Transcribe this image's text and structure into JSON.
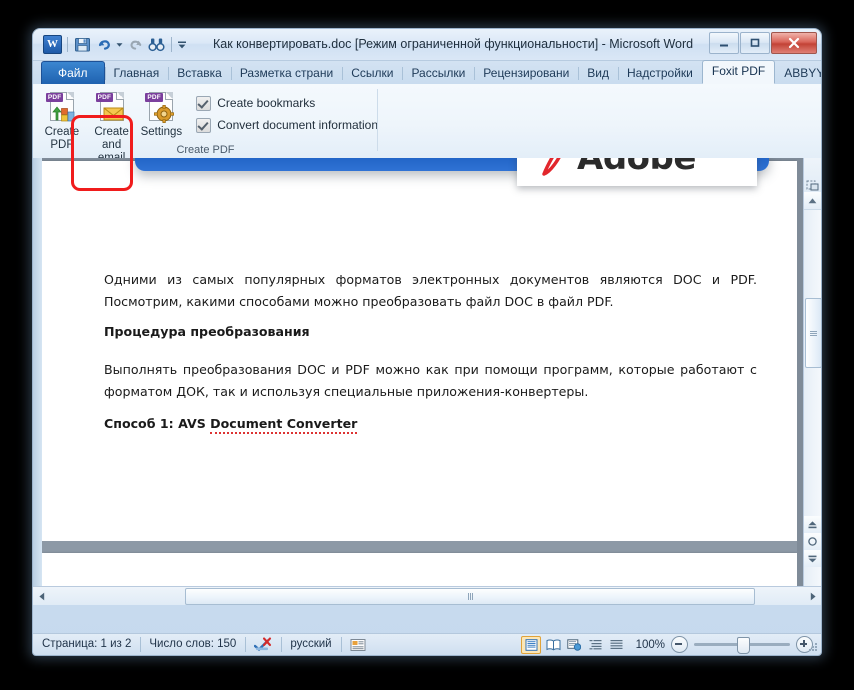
{
  "window": {
    "title": "Как конвертировать.doc [Режим ограниченной функциональности]  -  Microsoft Word",
    "app_icon_letter": "W",
    "buttons": {
      "minimize": "minimize-button",
      "maximize": "maximize-button",
      "close": "close-button"
    }
  },
  "quick_access": [
    {
      "name": "save-icon",
      "label": "Сохранить"
    },
    {
      "name": "undo-icon",
      "label": "Отменить"
    },
    {
      "name": "undo-dropdown-icon",
      "label": "Отменить список"
    },
    {
      "name": "redo-icon",
      "label": "Вернуть"
    },
    {
      "name": "find-icon",
      "label": "Найти"
    },
    {
      "name": "customize-qat-icon",
      "label": "Настройка панели быстрого доступа"
    }
  ],
  "ribbon": {
    "tabs": [
      {
        "label": "Файл",
        "type": "file"
      },
      {
        "label": "Главная",
        "type": "normal"
      },
      {
        "label": "Вставка",
        "type": "normal"
      },
      {
        "label": "Разметка страни",
        "type": "normal"
      },
      {
        "label": "Ссылки",
        "type": "normal"
      },
      {
        "label": "Рассылки",
        "type": "normal"
      },
      {
        "label": "Рецензировани",
        "type": "normal"
      },
      {
        "label": "Вид",
        "type": "normal"
      },
      {
        "label": "Надстройки",
        "type": "normal"
      },
      {
        "label": "Foxit PDF",
        "type": "active"
      },
      {
        "label": "ABBYY PDF Trans",
        "type": "normal"
      }
    ],
    "help_icon": "help-icon",
    "collapse_icon": "collapse-ribbon-icon",
    "group": {
      "label": "Create PDF",
      "buttons": [
        {
          "name": "create-pdf-button",
          "line1": "Create",
          "line2": "PDF"
        },
        {
          "name": "create-and-email-button",
          "line1": "Create",
          "line2": "and email"
        },
        {
          "name": "settings-button",
          "line1": "Settings",
          "line2": ""
        }
      ],
      "checkboxes": [
        {
          "name": "create-bookmarks-checkbox",
          "label": "Create bookmarks",
          "checked": true
        },
        {
          "name": "convert-document-information-checkbox",
          "label": "Convert document information",
          "checked": true
        }
      ]
    }
  },
  "document": {
    "banner_brand": "Adobe",
    "paragraphs": [
      {
        "style": "normal",
        "text": "Одними из самых популярных форматов электронных документов являются DOC и PDF. Посмотрим, какими способами можно преобразовать файл DOC в файл PDF."
      },
      {
        "style": "bold",
        "text": "Процедура преобразования"
      },
      {
        "style": "normal",
        "text": "Выполнять преобразования DOC и PDF можно как при помощи программ, которые работают с форматом ДОК, так и используя специальные приложения-конвертеры."
      }
    ],
    "heading_prefix": "Способ 1: AVS ",
    "heading_spelled": "Document Converter"
  },
  "status_bar": {
    "page": "Страница: 1 из 2",
    "words": "Число слов: 150",
    "proofing_icon": "spellcheck-error-icon",
    "language": "русский",
    "macro_icon": "record-macro-icon",
    "view_buttons": [
      {
        "name": "print-layout-view-button",
        "selected": true
      },
      {
        "name": "full-screen-reading-view-button",
        "selected": false
      },
      {
        "name": "web-layout-view-button",
        "selected": false
      },
      {
        "name": "outline-view-button",
        "selected": false
      },
      {
        "name": "draft-view-button",
        "selected": false
      }
    ],
    "zoom_level": "100%",
    "zoom_out_icon": "zoom-out-icon",
    "zoom_in_icon": "zoom-in-icon"
  },
  "scrollbars": {
    "vertical": {
      "up_icon": "scroll-up-icon",
      "down_icon": "scroll-down-icon",
      "previous_page_icon": "previous-page-icon",
      "select_browse_object_icon": "select-browse-object-icon",
      "next_page_icon": "next-page-icon",
      "split_icon": "split-window-icon",
      "object_icon": "select-object-icon"
    },
    "horizontal": {
      "left_icon": "scroll-left-icon",
      "right_icon": "scroll-right-icon"
    }
  },
  "colors": {
    "accent_blue": "#1f62b0",
    "annotation_red": "#f01c1c",
    "pdf_purple": "#7b3f9d",
    "adobe_red": "#e2262c",
    "window_chrome": "#cfdff0"
  }
}
